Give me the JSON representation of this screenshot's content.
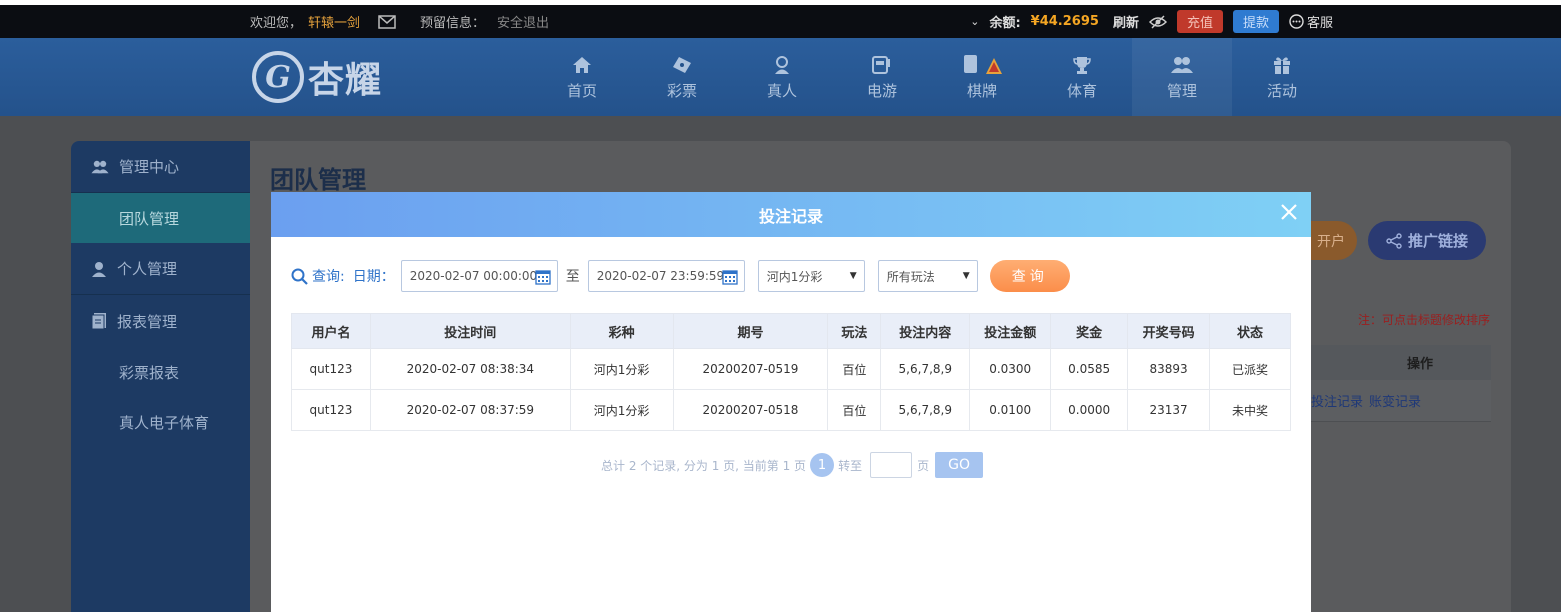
{
  "topbar": {
    "welcome": "欢迎您，",
    "username": "轩辕一剑",
    "reserve_label": "预留信息：",
    "logout": "安全退出",
    "balance_label": "余额:",
    "balance_value": "¥44.2695",
    "refresh": "刷新",
    "recharge": "充值",
    "withdraw": "提款",
    "service": "客服"
  },
  "logo": {
    "text": "杏耀"
  },
  "nav": [
    {
      "label": "首页",
      "icon": "home-icon"
    },
    {
      "label": "彩票",
      "icon": "ticket-icon"
    },
    {
      "label": "真人",
      "icon": "dealer-icon"
    },
    {
      "label": "电游",
      "icon": "slot-icon"
    },
    {
      "label": "棋牌",
      "icon": "cards-icon"
    },
    {
      "label": "体育",
      "icon": "trophy-icon"
    },
    {
      "label": "管理",
      "icon": "users-icon"
    },
    {
      "label": "活动",
      "icon": "gift-icon"
    }
  ],
  "sidebar": {
    "manage_center": "管理中心",
    "team_manage": "团队管理",
    "personal_manage": "个人管理",
    "report_manage": "报表管理",
    "lottery_report": "彩票报表",
    "live_report": "真人电子体育"
  },
  "content": {
    "title": "团队管理",
    "hint": "注：可点击标题修改排序",
    "promo_link": "推广链接",
    "open_account": "开户",
    "ops_header": "操作",
    "ops_links": [
      "投注记录",
      "账变记录"
    ]
  },
  "modal": {
    "title": "投注记录",
    "query_label": "查询:",
    "date_label": "日期：",
    "start_date": "2020-02-07 00:00:00",
    "to_label": "至",
    "end_date": "2020-02-07 23:59:59",
    "lottery_select": "河内1分彩",
    "play_select": "所有玩法",
    "query_button": "查询",
    "table": {
      "headers": [
        "用户名",
        "投注时间",
        "彩种",
        "期号",
        "玩法",
        "投注内容",
        "投注金额",
        "奖金",
        "开奖号码",
        "状态"
      ],
      "rows": [
        [
          "qut123",
          "2020-02-07 08:38:34",
          "河内1分彩",
          "20200207-0519",
          "百位",
          "5,6,7,8,9",
          "0.0300",
          "0.0585",
          "83893",
          "已派奖"
        ],
        [
          "qut123",
          "2020-02-07 08:37:59",
          "河内1分彩",
          "20200207-0518",
          "百位",
          "5,6,7,8,9",
          "0.0100",
          "0.0000",
          "23137",
          "未中奖"
        ]
      ]
    },
    "pager": {
      "summary": "总计 2 个记录, 分为 1 页, 当前第 1 页",
      "current": "1",
      "goto_label": "转至",
      "page_label": "页",
      "go_button": "GO"
    }
  },
  "colors": {
    "topbar_bg": "#0b0d12",
    "header_bg": "#2b5e9c",
    "modal_header_from": "#6b9ff0",
    "modal_header_to": "#7fd0f5",
    "status_paid": "#e67e22",
    "query_button": "#fb8e4a"
  }
}
